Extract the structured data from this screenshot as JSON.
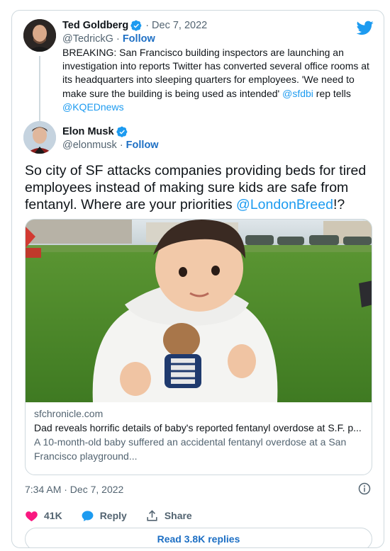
{
  "quoted_tweet": {
    "name": "Ted Goldberg",
    "date": "Dec 7, 2022",
    "handle": "@TedrickG",
    "follow": "Follow",
    "text_parts": [
      "BREAKING: San Francisco building inspectors are launching an investigation into reports Twitter has  converted several office rooms at its headquarters into sleeping quarters for employees. 'We need to make sure the building is being used as intended' ",
      "@sfdbi",
      " rep tells ",
      "@KQEDnews"
    ]
  },
  "tweet": {
    "name": "Elon Musk",
    "handle": "@elonmusk",
    "follow": "Follow",
    "text_before": "So city of SF attacks companies providing beds for tired employees instead of making sure kids are safe from fentanyl. Where are your priorities ",
    "mention": "@LondonBreed",
    "text_after": "!?",
    "timestamp": "7:34 AM · Dec 7, 2022"
  },
  "link_card": {
    "domain": "sfchronicle.com",
    "title": "Dad reveals horrific details of baby's reported fentanyl overdose at S.F. p...",
    "description": "A 10-month-old baby suffered an accidental fentanyl overdose at a San Francisco playground..."
  },
  "actions": {
    "likes": "41K",
    "reply": "Reply",
    "share": "Share"
  },
  "read_replies": "Read 3.8K replies",
  "colors": {
    "brand": "#1d9bf0",
    "link": "#1d6fc4",
    "like": "#f91880",
    "secondary_text": "#536471",
    "border": "#cfd9de"
  },
  "icons": [
    "twitter-bird-icon",
    "verified-badge-icon",
    "info-icon",
    "heart-icon",
    "reply-bubble-icon",
    "share-icon"
  ]
}
